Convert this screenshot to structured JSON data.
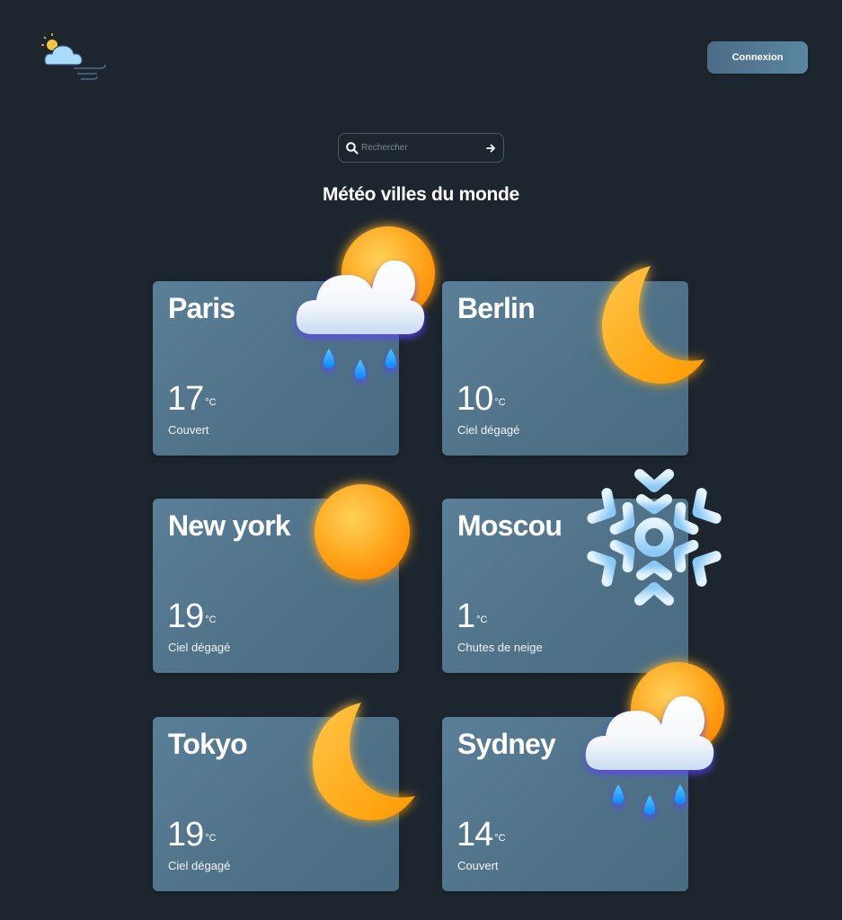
{
  "header": {
    "logo_icon": "cloud-sun-wind-icon",
    "login_label": "Connexion"
  },
  "search": {
    "placeholder": "Rechercher",
    "value": "",
    "icon": "search-icon",
    "submit_icon": "arrow-right-icon"
  },
  "main": {
    "title": "Météo villes du monde"
  },
  "cities": [
    {
      "name": "Paris",
      "temp": "17",
      "unit": "°C",
      "condition": "Couvert",
      "icon": "sun-cloud-rain-icon"
    },
    {
      "name": "Berlin",
      "temp": "10",
      "unit": "°C",
      "condition": "Ciel dégagé",
      "icon": "crescent-moon-icon"
    },
    {
      "name": "New york",
      "temp": "19",
      "unit": "°C",
      "condition": "Ciel dégagé",
      "icon": "sun-icon"
    },
    {
      "name": "Moscou",
      "temp": "1",
      "unit": "°C",
      "condition": "Chutes de neige",
      "icon": "snowflake-icon"
    },
    {
      "name": "Tokyo",
      "temp": "19",
      "unit": "°C",
      "condition": "Ciel dégagé",
      "icon": "crescent-moon-icon"
    },
    {
      "name": "Sydney",
      "temp": "14",
      "unit": "°C",
      "condition": "Couvert",
      "icon": "sun-cloud-rain-icon"
    }
  ],
  "colors": {
    "background": "#1d262e",
    "card": "#557a93",
    "accent": "#5a86a2",
    "sun": "#ffa31a",
    "rain": "#1ea8ff",
    "snow": "#bfe4ff"
  }
}
